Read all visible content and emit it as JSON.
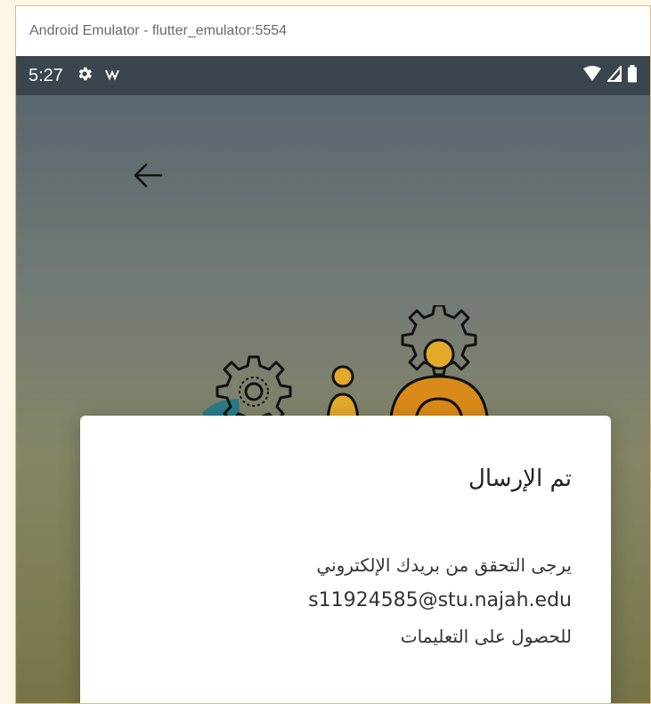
{
  "window": {
    "title": "Android Emulator - flutter_emulator:5554"
  },
  "status_bar": {
    "time": "5:27",
    "left_icons": [
      "settings-gear-icon",
      "notification-icon"
    ],
    "right_icons": [
      "wifi-icon",
      "signal-icon",
      "battery-icon"
    ],
    "background": "#3a454d"
  },
  "app": {
    "back_icon": "arrow-back-icon",
    "illustration": "gears-and-people-icon",
    "dialog": {
      "title": "تم الإرسال",
      "message_line1": "يرجى التحقق من بريدك الإلكتروني",
      "email": "s11924585@stu.najah.edu",
      "message_line3": "للحصول على التعليمات"
    }
  }
}
